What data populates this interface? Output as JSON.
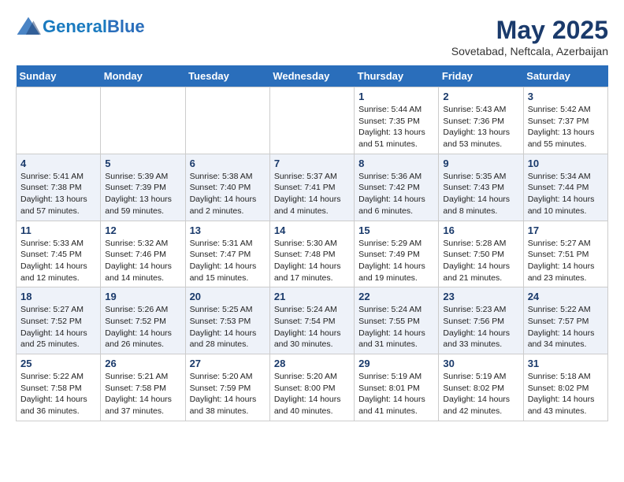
{
  "header": {
    "logo_line1": "General",
    "logo_line2": "Blue",
    "month_title": "May 2025",
    "subtitle": "Sovetabad, Neftcala, Azerbaijan"
  },
  "days_of_week": [
    "Sunday",
    "Monday",
    "Tuesday",
    "Wednesday",
    "Thursday",
    "Friday",
    "Saturday"
  ],
  "weeks": [
    [
      {
        "day": "",
        "info": ""
      },
      {
        "day": "",
        "info": ""
      },
      {
        "day": "",
        "info": ""
      },
      {
        "day": "",
        "info": ""
      },
      {
        "day": "1",
        "info": "Sunrise: 5:44 AM\nSunset: 7:35 PM\nDaylight: 13 hours\nand 51 minutes."
      },
      {
        "day": "2",
        "info": "Sunrise: 5:43 AM\nSunset: 7:36 PM\nDaylight: 13 hours\nand 53 minutes."
      },
      {
        "day": "3",
        "info": "Sunrise: 5:42 AM\nSunset: 7:37 PM\nDaylight: 13 hours\nand 55 minutes."
      }
    ],
    [
      {
        "day": "4",
        "info": "Sunrise: 5:41 AM\nSunset: 7:38 PM\nDaylight: 13 hours\nand 57 minutes."
      },
      {
        "day": "5",
        "info": "Sunrise: 5:39 AM\nSunset: 7:39 PM\nDaylight: 13 hours\nand 59 minutes."
      },
      {
        "day": "6",
        "info": "Sunrise: 5:38 AM\nSunset: 7:40 PM\nDaylight: 14 hours\nand 2 minutes."
      },
      {
        "day": "7",
        "info": "Sunrise: 5:37 AM\nSunset: 7:41 PM\nDaylight: 14 hours\nand 4 minutes."
      },
      {
        "day": "8",
        "info": "Sunrise: 5:36 AM\nSunset: 7:42 PM\nDaylight: 14 hours\nand 6 minutes."
      },
      {
        "day": "9",
        "info": "Sunrise: 5:35 AM\nSunset: 7:43 PM\nDaylight: 14 hours\nand 8 minutes."
      },
      {
        "day": "10",
        "info": "Sunrise: 5:34 AM\nSunset: 7:44 PM\nDaylight: 14 hours\nand 10 minutes."
      }
    ],
    [
      {
        "day": "11",
        "info": "Sunrise: 5:33 AM\nSunset: 7:45 PM\nDaylight: 14 hours\nand 12 minutes."
      },
      {
        "day": "12",
        "info": "Sunrise: 5:32 AM\nSunset: 7:46 PM\nDaylight: 14 hours\nand 14 minutes."
      },
      {
        "day": "13",
        "info": "Sunrise: 5:31 AM\nSunset: 7:47 PM\nDaylight: 14 hours\nand 15 minutes."
      },
      {
        "day": "14",
        "info": "Sunrise: 5:30 AM\nSunset: 7:48 PM\nDaylight: 14 hours\nand 17 minutes."
      },
      {
        "day": "15",
        "info": "Sunrise: 5:29 AM\nSunset: 7:49 PM\nDaylight: 14 hours\nand 19 minutes."
      },
      {
        "day": "16",
        "info": "Sunrise: 5:28 AM\nSunset: 7:50 PM\nDaylight: 14 hours\nand 21 minutes."
      },
      {
        "day": "17",
        "info": "Sunrise: 5:27 AM\nSunset: 7:51 PM\nDaylight: 14 hours\nand 23 minutes."
      }
    ],
    [
      {
        "day": "18",
        "info": "Sunrise: 5:27 AM\nSunset: 7:52 PM\nDaylight: 14 hours\nand 25 minutes."
      },
      {
        "day": "19",
        "info": "Sunrise: 5:26 AM\nSunset: 7:52 PM\nDaylight: 14 hours\nand 26 minutes."
      },
      {
        "day": "20",
        "info": "Sunrise: 5:25 AM\nSunset: 7:53 PM\nDaylight: 14 hours\nand 28 minutes."
      },
      {
        "day": "21",
        "info": "Sunrise: 5:24 AM\nSunset: 7:54 PM\nDaylight: 14 hours\nand 30 minutes."
      },
      {
        "day": "22",
        "info": "Sunrise: 5:24 AM\nSunset: 7:55 PM\nDaylight: 14 hours\nand 31 minutes."
      },
      {
        "day": "23",
        "info": "Sunrise: 5:23 AM\nSunset: 7:56 PM\nDaylight: 14 hours\nand 33 minutes."
      },
      {
        "day": "24",
        "info": "Sunrise: 5:22 AM\nSunset: 7:57 PM\nDaylight: 14 hours\nand 34 minutes."
      }
    ],
    [
      {
        "day": "25",
        "info": "Sunrise: 5:22 AM\nSunset: 7:58 PM\nDaylight: 14 hours\nand 36 minutes."
      },
      {
        "day": "26",
        "info": "Sunrise: 5:21 AM\nSunset: 7:58 PM\nDaylight: 14 hours\nand 37 minutes."
      },
      {
        "day": "27",
        "info": "Sunrise: 5:20 AM\nSunset: 7:59 PM\nDaylight: 14 hours\nand 38 minutes."
      },
      {
        "day": "28",
        "info": "Sunrise: 5:20 AM\nSunset: 8:00 PM\nDaylight: 14 hours\nand 40 minutes."
      },
      {
        "day": "29",
        "info": "Sunrise: 5:19 AM\nSunset: 8:01 PM\nDaylight: 14 hours\nand 41 minutes."
      },
      {
        "day": "30",
        "info": "Sunrise: 5:19 AM\nSunset: 8:02 PM\nDaylight: 14 hours\nand 42 minutes."
      },
      {
        "day": "31",
        "info": "Sunrise: 5:18 AM\nSunset: 8:02 PM\nDaylight: 14 hours\nand 43 minutes."
      }
    ]
  ]
}
